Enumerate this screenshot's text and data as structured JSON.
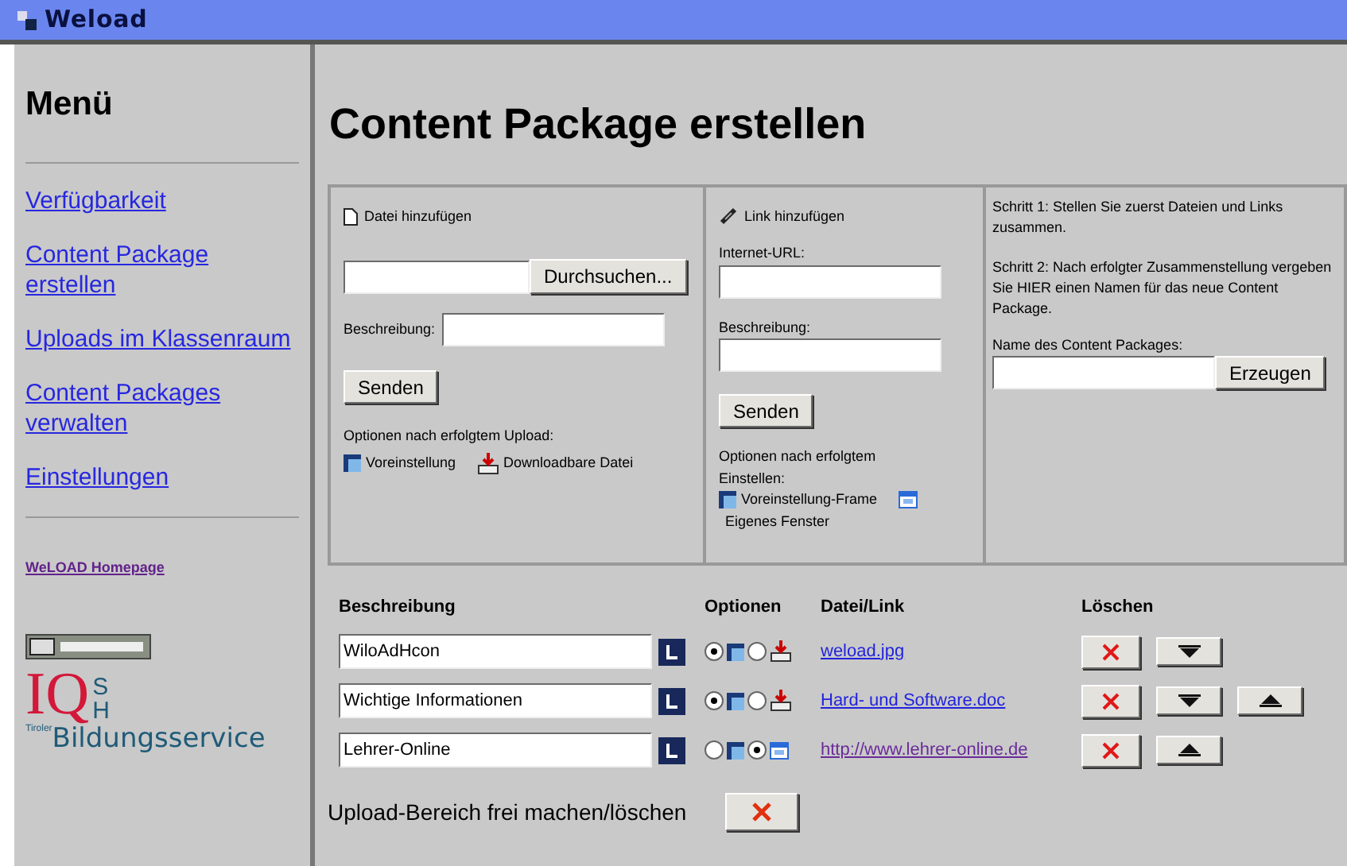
{
  "window": {
    "title": "Weload"
  },
  "sidebar": {
    "heading": "Menü",
    "items": [
      {
        "label": "Verfügbarkeit"
      },
      {
        "label": "Content Package erstellen"
      },
      {
        "label": "Uploads im Klassenraum"
      },
      {
        "label": "Content Packages verwalten"
      },
      {
        "label": "Einstellungen"
      }
    ],
    "homepage_link": "WeLOAD Homepage",
    "logo": {
      "letters": "IQ",
      "vertical": "SH",
      "prefix": "Tiroler",
      "name": "Bildungsservice"
    }
  },
  "main": {
    "title": "Content Package erstellen",
    "file_panel": {
      "heading": "Datei hinzufügen",
      "browse_button": "Durchsuchen...",
      "description_label": "Beschreibung:",
      "send_button": "Senden",
      "options_label": "Optionen nach erfolgtem Upload:",
      "option_1": "Voreinstellung",
      "option_2": "Downloadbare Datei"
    },
    "link_panel": {
      "heading": "Link hinzufügen",
      "url_label": "Internet-URL:",
      "description_label": "Beschreibung:",
      "send_button": "Senden",
      "options_label": "Optionen nach erfolgtem Einstellen:",
      "option_1": "Voreinstellung-Frame",
      "option_2": "Eigenes Fenster"
    },
    "package_panel": {
      "step_1": "Schritt 1: Stellen Sie zuerst Dateien und Links zusammen.",
      "step_2": "Schritt 2: Nach erfolgter Zusammenstellung vergeben Sie HIER einen Namen für das neue Content Package.",
      "name_label": "Name des Content Packages:",
      "create_button": "Erzeugen"
    },
    "table": {
      "columns": [
        "Beschreibung",
        "Optionen",
        "Datei/Link",
        "Löschen"
      ],
      "rows": [
        {
          "description": "WiloAdHcon",
          "options": [
            {
              "kind": "frame",
              "selected": true
            },
            {
              "kind": "download",
              "selected": false
            }
          ],
          "link": "weload.jpg",
          "visited": false,
          "moves": [
            {
              "kind": "down"
            }
          ]
        },
        {
          "description": "Wichtige Informationen",
          "options": [
            {
              "kind": "frame",
              "selected": true
            },
            {
              "kind": "download",
              "selected": false
            }
          ],
          "link": "Hard-  und  Software.doc",
          "visited": false,
          "moves": [
            {
              "kind": "down"
            },
            {
              "kind": "up"
            }
          ]
        },
        {
          "description": "Lehrer-Online",
          "options": [
            {
              "kind": "frame",
              "selected": false
            },
            {
              "kind": "window",
              "selected": true
            }
          ],
          "link": "http://www.lehrer-online.de",
          "visited": true,
          "moves": [
            {
              "kind": "up"
            }
          ]
        }
      ]
    },
    "clear_label": "Upload-Bereich frei machen/löschen"
  }
}
